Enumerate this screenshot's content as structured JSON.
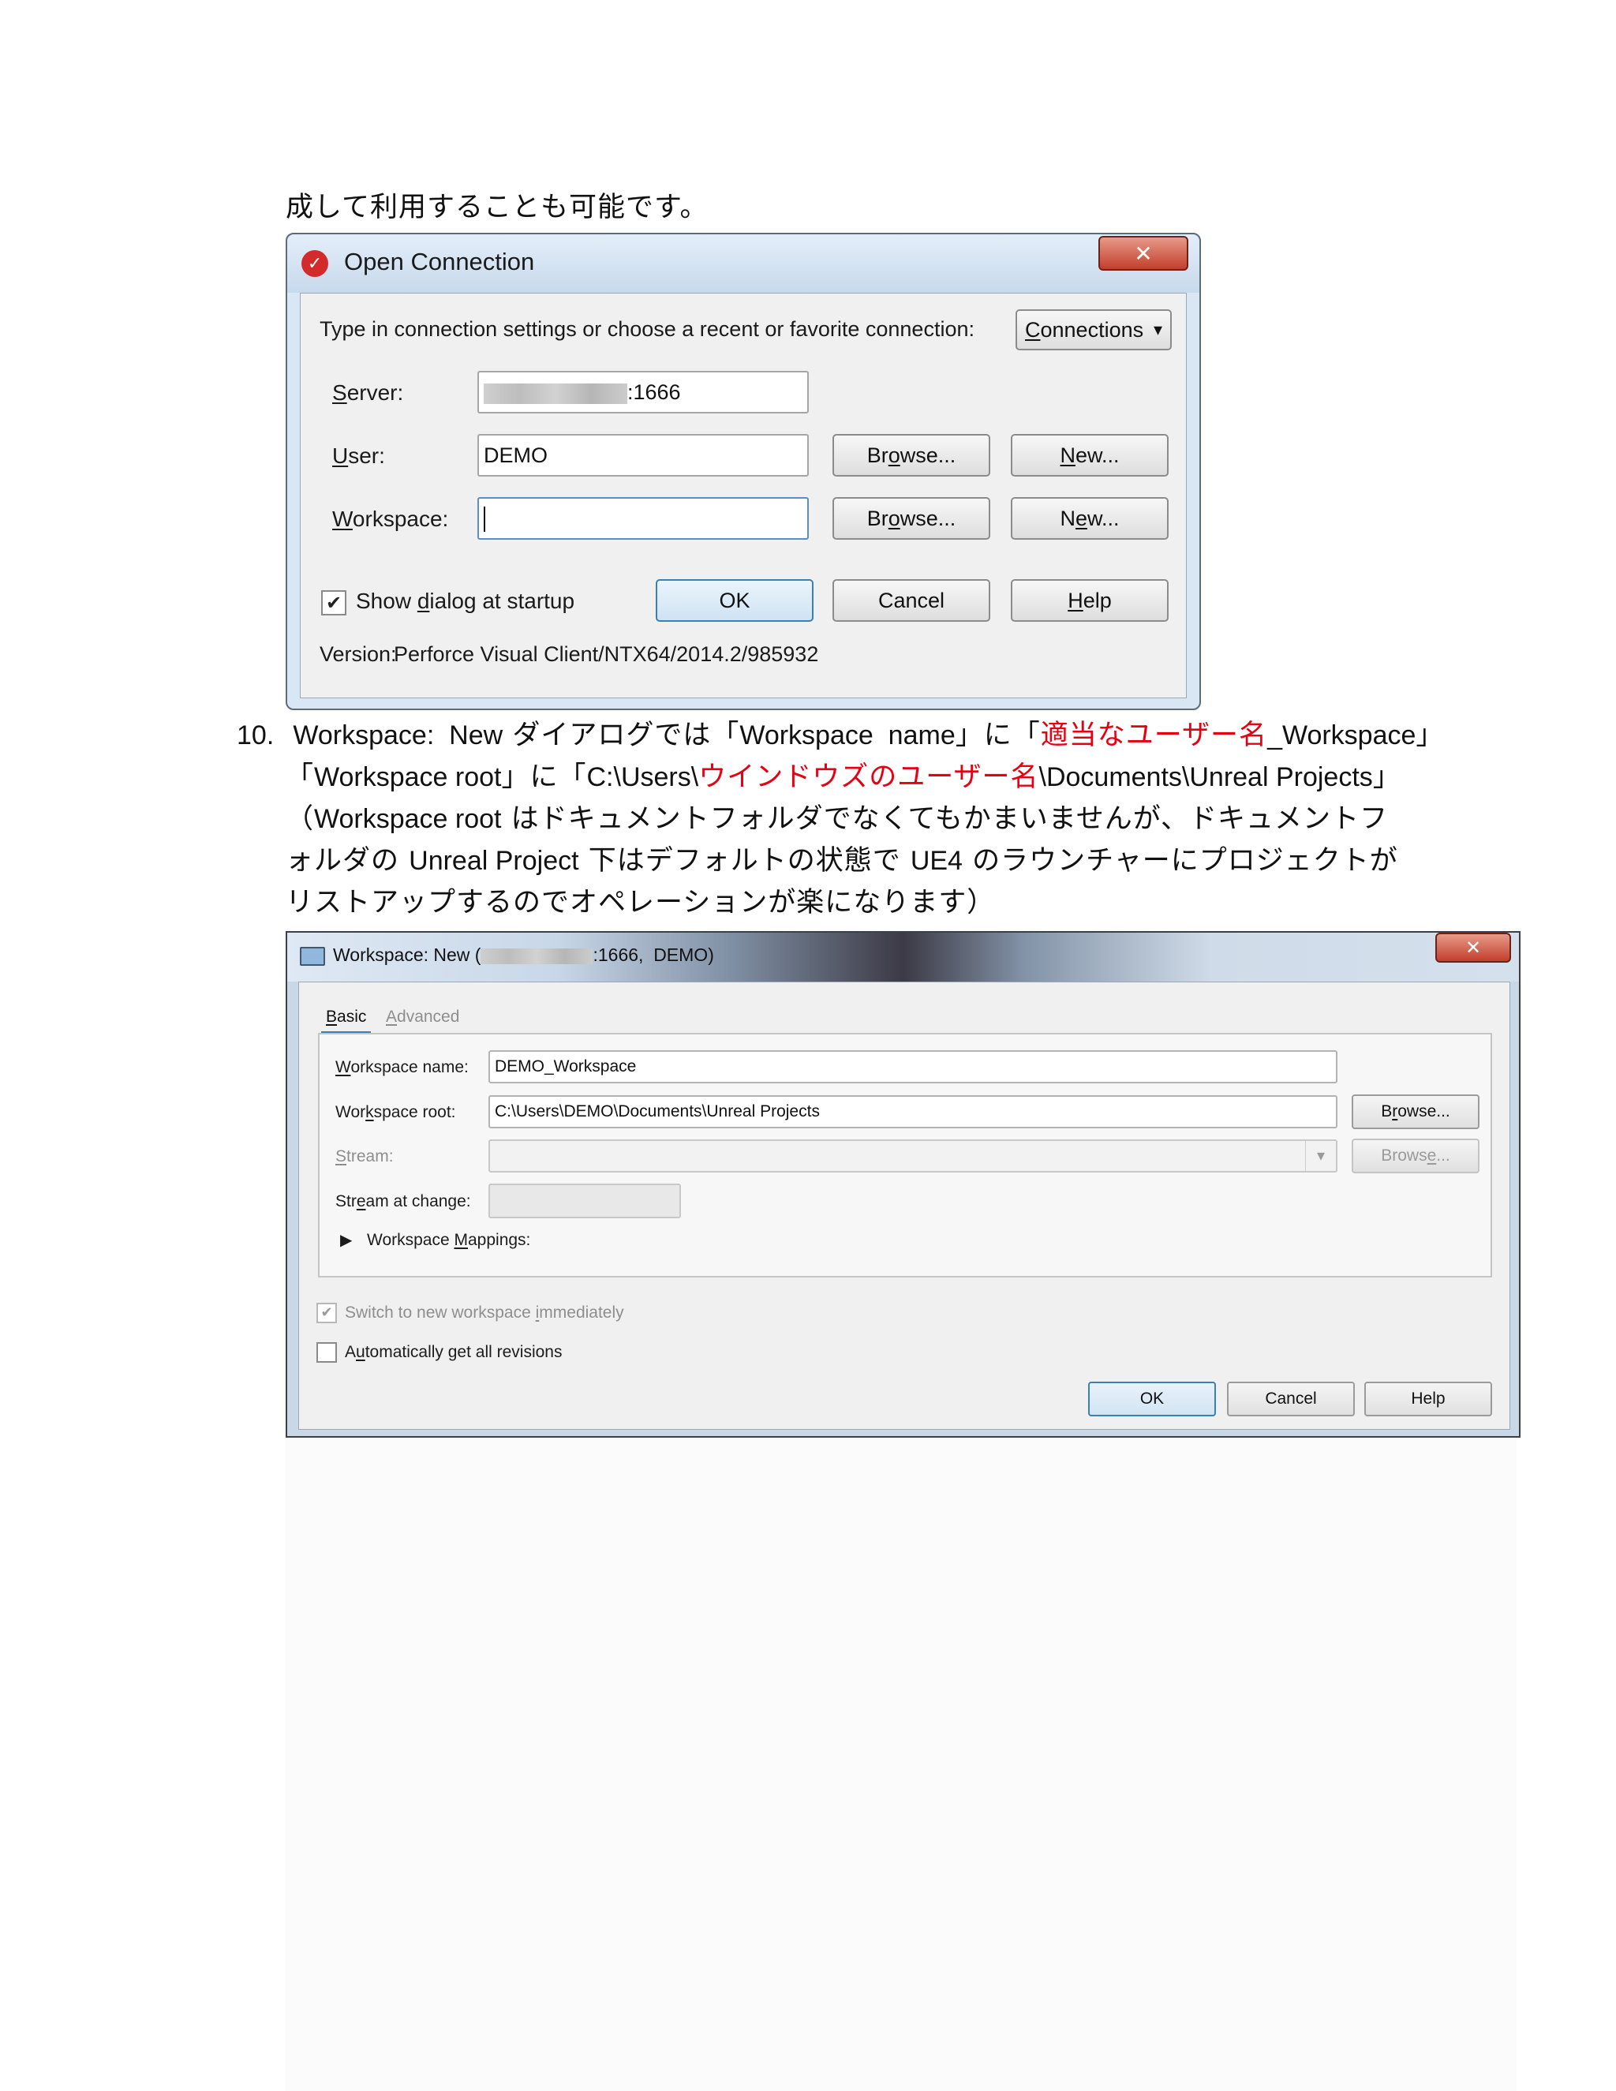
{
  "intro_line": "成して利用することも可能です。",
  "open_connection": {
    "title": "Open Connection",
    "close_glyph": "✕",
    "prompt": "Type in connection settings or choose a recent or favorite connection:",
    "connections_pre": "",
    "connections_mn": "C",
    "connections_post": "onnections",
    "server_pre": "",
    "server_mn": "S",
    "server_post": "erver:",
    "server_value_suffix": ":1666",
    "user_pre": "",
    "user_mn": "U",
    "user_post": "ser:",
    "user_value": "DEMO",
    "workspace_pre": "",
    "workspace_mn": "W",
    "workspace_post": "orkspace:",
    "browse_pre": "Br",
    "browse_mn": "o",
    "browse_post": "wse...",
    "new1_pre": "",
    "new1_mn": "N",
    "new1_post": "ew...",
    "new2_pre": "N",
    "new2_mn": "e",
    "new2_post": "w...",
    "show_dialog_pre": "Show ",
    "show_dialog_mn": "d",
    "show_dialog_post": "ialog at startup",
    "show_dialog_checked": true,
    "ok": "OK",
    "cancel": "Cancel",
    "help_pre": "",
    "help_mn": "H",
    "help_post": "elp",
    "version_label": "Version:",
    "version_value": "Perforce Visual Client/NTX64/2014.2/985932"
  },
  "step10": {
    "number": "10.",
    "l1_a": "Workspace:  New",
    "l1_b": " ダイアログでは「",
    "l1_c": "Workspace  name",
    "l1_d": "」に「",
    "l1_red": "適当なユーザー名",
    "l1_e": "_Workspace",
    "l1_f": "」",
    "l2_a": "「",
    "l2_b": "Workspace root",
    "l2_c": "」に「",
    "l2_d": "C:\\Users\\",
    "l2_red": "ウインドウズのユーザー名",
    "l2_e": "\\Documents\\Unreal Projects",
    "l2_f": "」",
    "l3_a": "（",
    "l3_b": "Workspace root",
    "l3_c": " はドキュメントフォルダでなくてもかまいませんが、ドキュメントフ",
    "l4_a": "ォルダの ",
    "l4_b": "Unreal Project",
    "l4_c": " 下はデフォルトの状態で ",
    "l4_d": "UE4",
    "l4_e": " のラウンチャーにプロジェクトが",
    "l5": "リストアップするのでオペレーションが楽になります）"
  },
  "workspace_dialog": {
    "title_prefix": "Workspace: New (",
    "title_suffix": ":1666,  DEMO)",
    "close_glyph": "✕",
    "tab_basic_pre": "",
    "tab_basic_mn": "B",
    "tab_basic_post": "asic",
    "tab_advanced_pre": "",
    "tab_advanced_mn": "A",
    "tab_advanced_post": "dvanced",
    "ws_name_pre": "",
    "ws_name_mn": "W",
    "ws_name_post": "orkspace name:",
    "ws_name_value": "DEMO_Workspace",
    "ws_root_pre": "Wor",
    "ws_root_mn": "k",
    "ws_root_post": "space root:",
    "ws_root_value": "C:\\Users\\DEMO\\Documents\\Unreal Projects",
    "browse1_pre": "B",
    "browse1_mn": "r",
    "browse1_post": "owse...",
    "stream_pre": "",
    "stream_mn": "S",
    "stream_post": "tream:",
    "browse2_pre": "Brows",
    "browse2_mn": "e",
    "browse2_post": "...",
    "stream_change_pre": "Str",
    "stream_change_mn": "e",
    "stream_change_post": "am at change:",
    "mappings_pre": "Workspace ",
    "mappings_mn": "M",
    "mappings_post": "appings:",
    "switch_pre": "Switch to new workspace ",
    "switch_mn": "i",
    "switch_post": "mmediately",
    "switch_checked": true,
    "auto_pre": "A",
    "auto_mn": "u",
    "auto_post": "tomatically get all revisions",
    "auto_checked": false,
    "ok": "OK",
    "cancel": "Cancel",
    "help": "Help"
  },
  "icons": {
    "app": "perforce-logo-icon",
    "monitor": "monitor-icon",
    "check": "✔",
    "triangle": "▶",
    "dropdown": "▾"
  },
  "colors": {
    "emphasis_red": "#e60012"
  }
}
